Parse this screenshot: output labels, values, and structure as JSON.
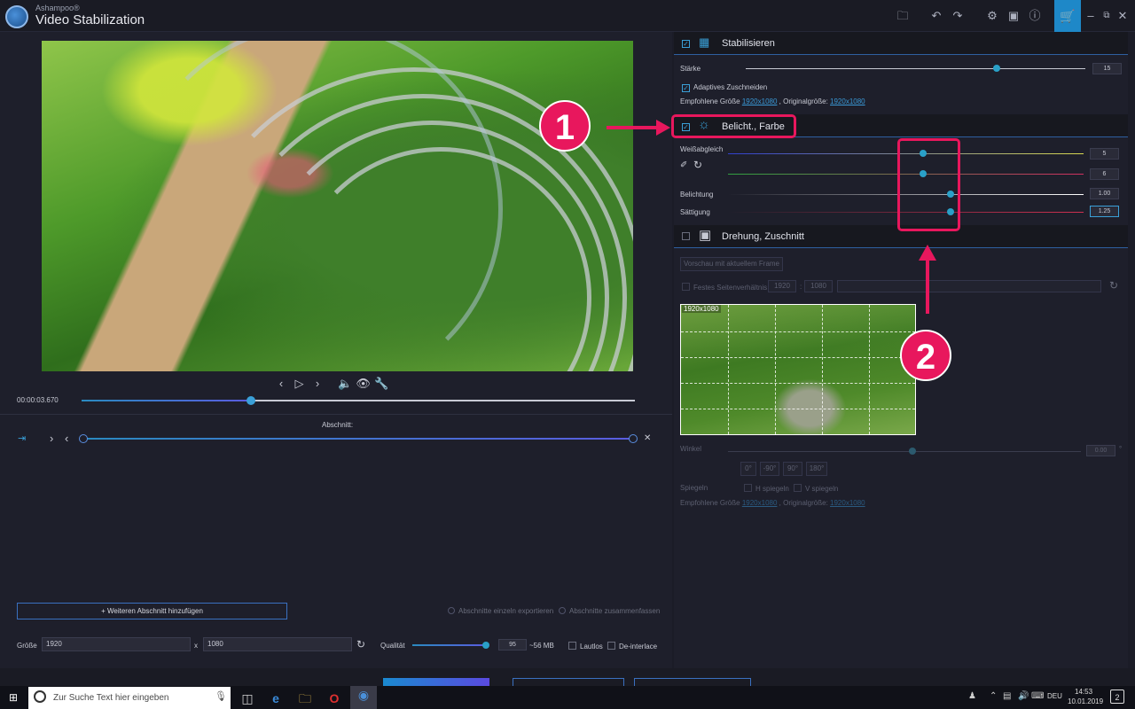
{
  "app": {
    "brand": "Ashampoo®",
    "title": "Video Stabilization"
  },
  "toolbar": {
    "folder_icon": "folder-icon",
    "undo_icon": "undo-icon",
    "redo_icon": "redo-icon",
    "settings_icon": "gear-icon",
    "image_icon": "image-icon",
    "info_icon": "info-icon",
    "cart_icon": "cart-icon"
  },
  "player": {
    "timecode": "00:00:03.670",
    "progress_fraction": 0.3,
    "segment_label": "Abschnitt:"
  },
  "bottom": {
    "add_segment": "Weiteren Abschnitt hinzufügen",
    "export_single": "Abschnitte einzeln exportieren",
    "export_merge": "Abschnitte zusammenfassen",
    "size_label": "Größe",
    "width": "1920",
    "x_sep": "x",
    "height": "1080",
    "quality_label": "Qualität",
    "quality_value": "95",
    "quality_size": "~56 MB",
    "mute_label": "Lautlos",
    "deinterlace_label": "De-interlace"
  },
  "stabilize": {
    "title": "Stabilisieren",
    "strength_label": "Stärke",
    "strength_value": "15",
    "adaptive_label": "Adaptives Zuschneiden",
    "recommended_label": "Empfohlene Größe",
    "recommended_value": "1920x1080",
    "original_label": ", Originalgröße:",
    "original_value": "1920x1080"
  },
  "light": {
    "title": "Belicht., Farbe",
    "wb_label": "Weißabgleich",
    "wb_value1": "5",
    "wb_value2": "6",
    "exposure_label": "Belichtung",
    "exposure_value": "1.00",
    "saturation_label": "Sättigung",
    "saturation_value": "1.25"
  },
  "crop": {
    "title": "Drehung, Zuschnitt",
    "preview_btn": "Vorschau mit aktuellem Frame",
    "fixed_ratio": "Festes Seitenverhältnis",
    "ratio_w": "1920",
    "ratio_sep": ":",
    "ratio_h": "1080",
    "thumb_label": "1920x1080",
    "angle_label": "Winkel",
    "angle_value": "0.00",
    "angle_unit": "°",
    "rot0": "0°",
    "rot_m90": "-90°",
    "rot90": "90°",
    "rot180": "180°",
    "mirror_label": "Spiegeln",
    "h_mirror": "H spiegeln",
    "v_mirror": "V spiegeln",
    "recommended_label": "Empfohlene Größe",
    "recommended_value": "1920x1080",
    "original_label": ", Originalgröße:",
    "original_value": "1920x1080"
  },
  "annotations": {
    "one": "1",
    "two": "2"
  },
  "taskbar": {
    "search_placeholder": "Zur Suche Text hier eingeben",
    "lang": "DEU",
    "time": "14:53",
    "date": "10.01.2019",
    "notif_count": "2"
  }
}
